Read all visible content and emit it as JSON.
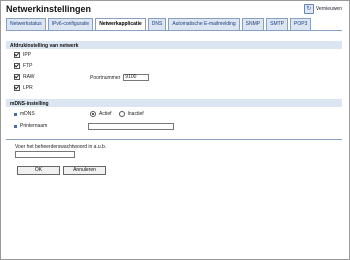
{
  "page": {
    "title": "Netwerkinstellingen",
    "refresh_label": "Vernieuwen"
  },
  "tabs": [
    {
      "label": "Netwerkstatus",
      "active": false
    },
    {
      "label": "IPv6-configuratie",
      "active": false
    },
    {
      "label": "Netwerkapplicatie",
      "active": true
    },
    {
      "label": "DNS",
      "active": false
    },
    {
      "label": "Automatische E-mailmelding",
      "active": false
    },
    {
      "label": "SNMP",
      "active": false
    },
    {
      "label": "SMTP",
      "active": false
    },
    {
      "label": "POP3",
      "active": false
    }
  ],
  "print_section": {
    "title": "Afdrukinstelling van netwerk",
    "items": [
      {
        "label": "IPP",
        "checked": true
      },
      {
        "label": "FTP",
        "checked": true
      },
      {
        "label": "RAW",
        "checked": true
      },
      {
        "label": "LPR",
        "checked": true
      }
    ],
    "port_label": "Poortnummer",
    "port_value": "9100"
  },
  "mdns_section": {
    "title": "mDNS-instelling",
    "mdns_label": "mDNS",
    "active_label": "Actief",
    "inactive_label": "Inactief",
    "active_selected": true,
    "printer_name_label": "Printernaam",
    "printer_name_value": ""
  },
  "admin": {
    "prompt": "Voer het beheerderswachtwoord in a.u.b.",
    "password_value": ""
  },
  "buttons": {
    "ok": "OK",
    "cancel": "Annuleren"
  }
}
